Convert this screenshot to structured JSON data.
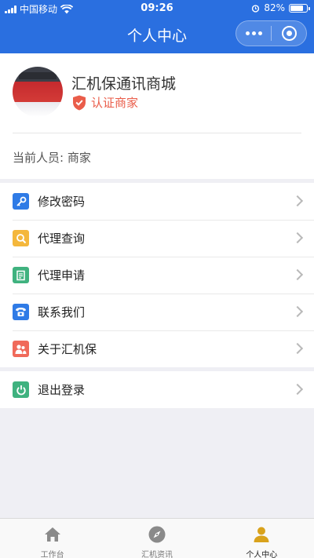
{
  "status_bar": {
    "carrier": "中国移动",
    "time": "09:26",
    "battery": "82%",
    "battery_level": 0.82
  },
  "navbar": {
    "title": "个人中心"
  },
  "profile": {
    "shop_name": "汇机保通讯商城",
    "cert_label": "认证商家",
    "current_person": "当前人员: 商家"
  },
  "menu": {
    "items": [
      {
        "label": "修改密码",
        "icon": "key-icon",
        "color": "#2f7be6"
      },
      {
        "label": "代理查询",
        "icon": "search-icon",
        "color": "#f4b73c"
      },
      {
        "label": "代理申请",
        "icon": "form-icon",
        "color": "#3fb27f"
      },
      {
        "label": "联系我们",
        "icon": "phone-icon",
        "color": "#2f7be6"
      },
      {
        "label": "关于汇机保",
        "icon": "people-icon",
        "color": "#f06a5a"
      }
    ],
    "logout": {
      "label": "退出登录",
      "icon": "power-icon",
      "color": "#3fb27f"
    }
  },
  "tabbar": {
    "tabs": [
      {
        "label": "工作台",
        "icon": "home-icon"
      },
      {
        "label": "汇机资讯",
        "icon": "compass-icon"
      },
      {
        "label": "个人中心",
        "icon": "person-icon",
        "active": true
      }
    ]
  },
  "colors": {
    "primary": "#2a6fe0",
    "cert": "#ea5d4a",
    "active_tab_icon": "#d9a21c"
  }
}
